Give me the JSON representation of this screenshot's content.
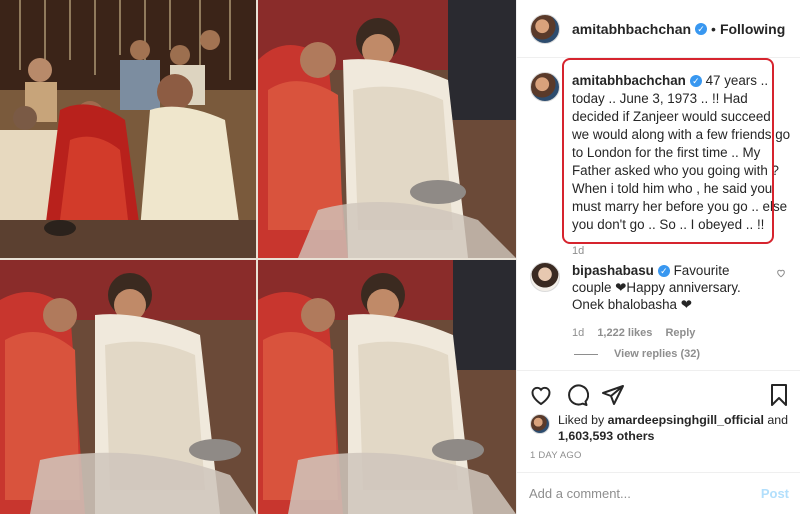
{
  "post": {
    "username": "amitabhbachchan",
    "follow_label": "Following",
    "caption": "47 years .. today .. June 3, 1973 .. !! Had decided if Zanjeer would succeed, we would along with a few friends go to London for the first time .. My Father asked who you going with ? When i told him who , he said you must marry her before you go .. else you don't go .. So .. I obeyed .. !!",
    "caption_time": "1d"
  },
  "comment": {
    "username": "bipashabasu",
    "text": "Favourite couple ❤Happy anniversary. Onek bhalobasha ❤",
    "time": "1d",
    "likes": "1,222 likes",
    "reply_label": "Reply",
    "view_replies": "View replies (32)"
  },
  "likes": {
    "liked_by_prefix": "Liked by",
    "liked_user": "amardeepsinghgill_official",
    "and": "and",
    "others": "1,603,593 others"
  },
  "date": "1 DAY AGO",
  "add_comment": {
    "placeholder": "Add a comment...",
    "post_label": "Post"
  },
  "icons": [
    "heart-icon",
    "comment-icon",
    "share-icon",
    "bookmark-icon",
    "verified-icon"
  ],
  "colors": {
    "highlight": "#d6242e",
    "verified": "#3897f0",
    "post_disabled": "#b2dffc"
  }
}
